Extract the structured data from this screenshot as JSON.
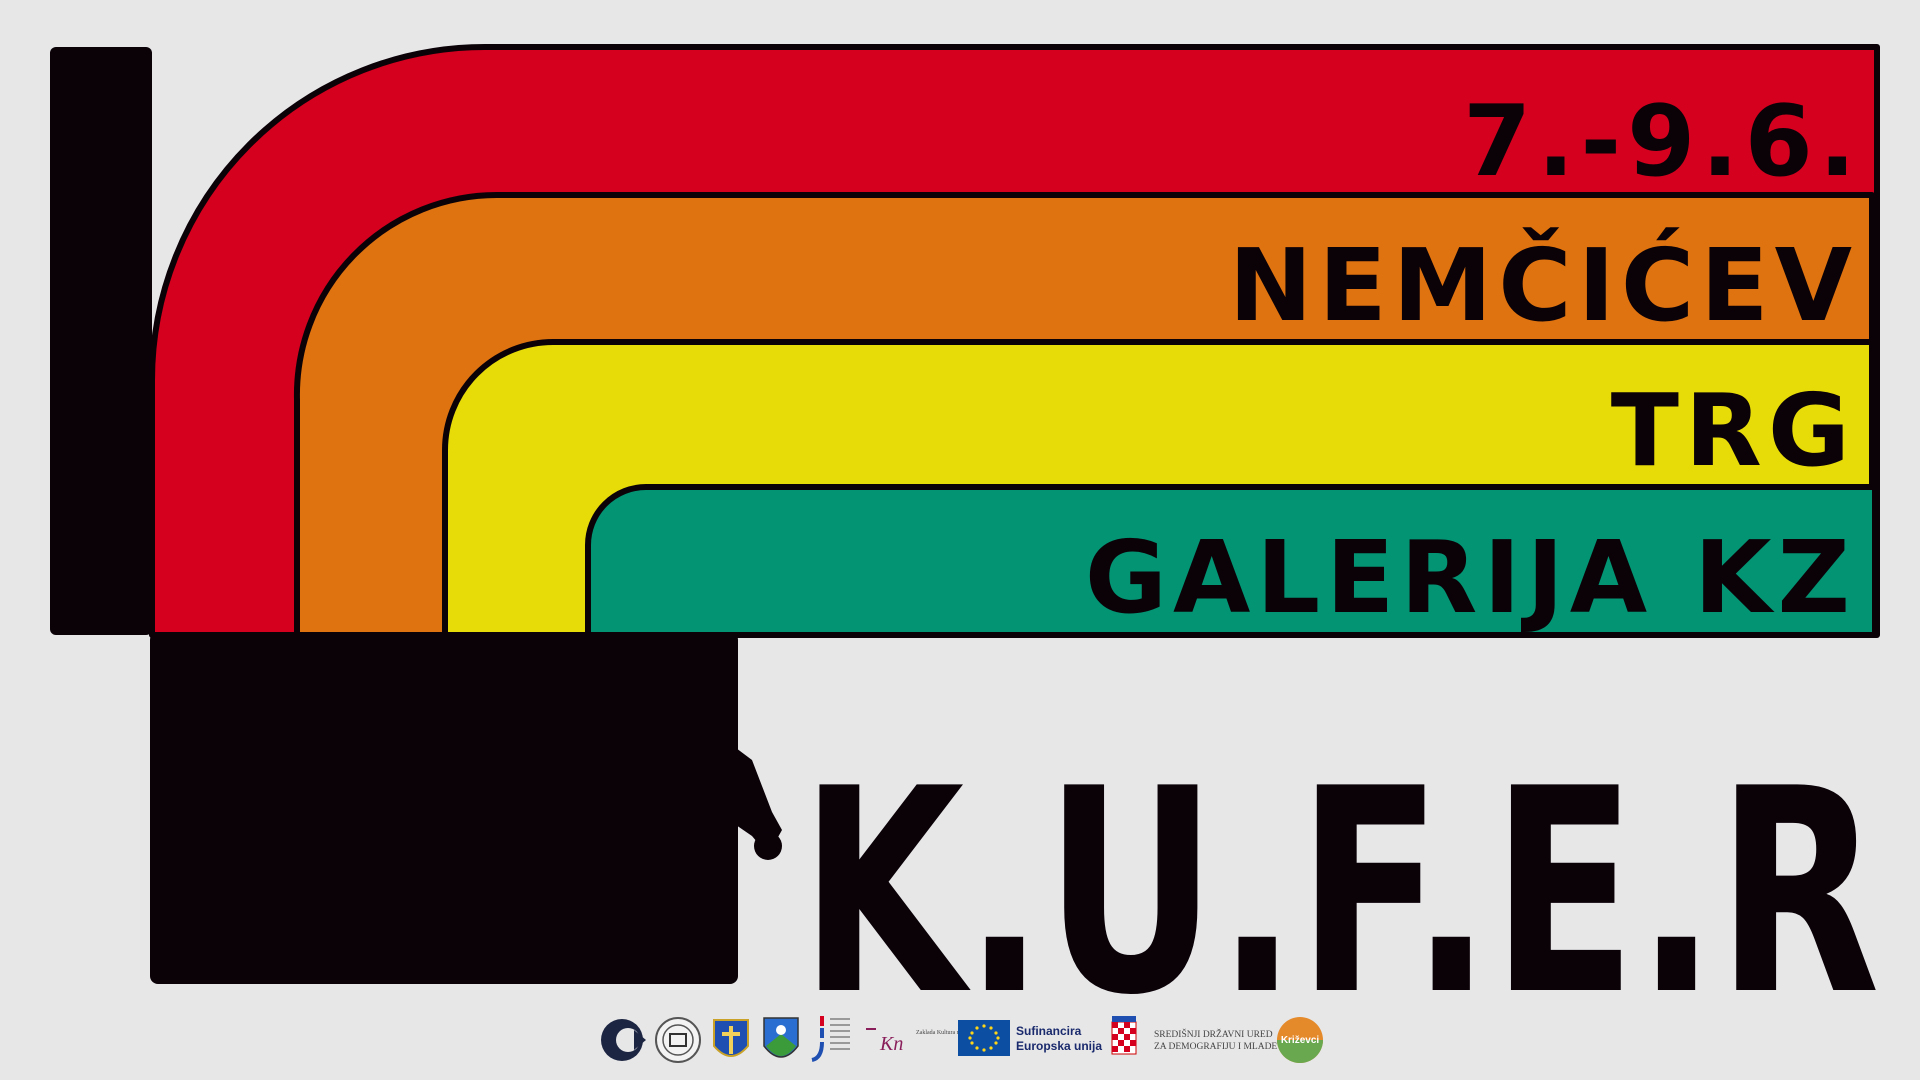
{
  "event": {
    "dates": "7.-9.6.",
    "venue_1": "NEMČIĆEV",
    "venue_2": "TRG",
    "venue_3": "GALERIJA KZ",
    "brand": "K.U.F.E.R"
  },
  "colors": {
    "background": "#e7e7e8",
    "red": "#d4001e",
    "orange": "#df730f",
    "yellow": "#e7dc07",
    "green": "#029473",
    "dark": "#0b0208",
    "eu_blue": "#0b4ea2",
    "eu_star": "#ffd617"
  },
  "sponsors": {
    "eu_line1": "Sufinancira",
    "eu_line2": "Europska unija",
    "office_line1": "SREDIŠNJI DRŽAVNI URED",
    "office_line2": "ZA DEMOGRAFIJU I MLADE",
    "city": "Križevci",
    "kn_logo": "Kn",
    "kn_caption": "Zaklada Kultura nova"
  }
}
